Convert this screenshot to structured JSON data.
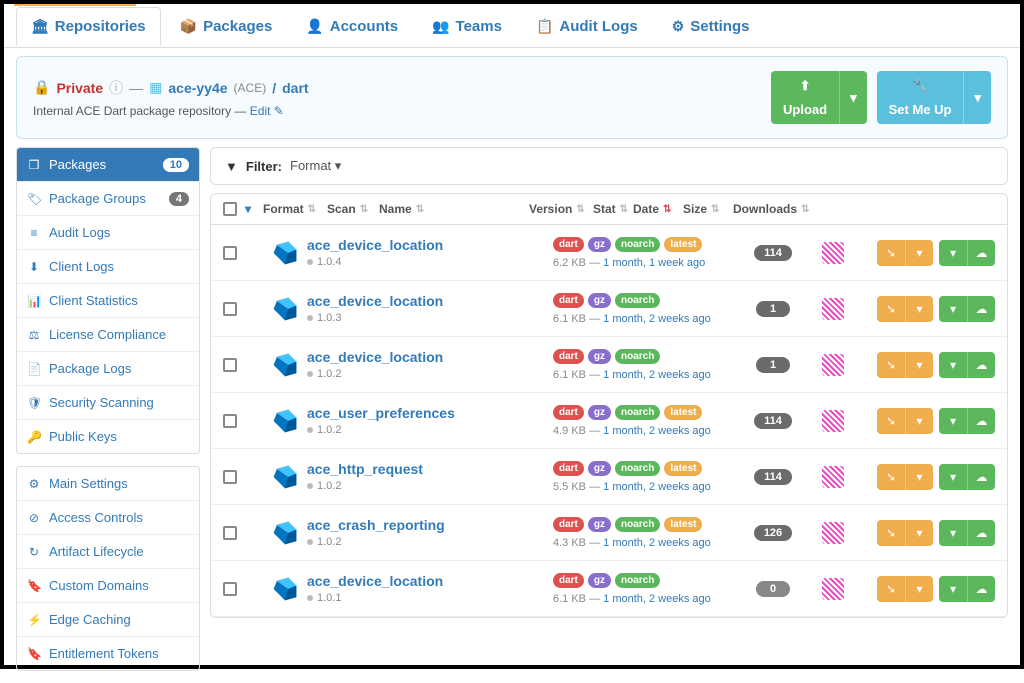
{
  "top_tabs": {
    "repositories": "Repositories",
    "packages": "Packages",
    "accounts": "Accounts",
    "teams": "Teams",
    "audit_logs": "Audit Logs",
    "settings": "Settings"
  },
  "header": {
    "privacy": "Private",
    "org": "ace-yy4e",
    "org_suffix": "(ACE)",
    "repo": "dart",
    "description": "Internal ACE Dart package repository —",
    "edit": "Edit",
    "upload": "Upload",
    "setup": "Set Me Up"
  },
  "sidebar": {
    "group1": [
      {
        "label": "Packages",
        "badge": "10",
        "active": true
      },
      {
        "label": "Package Groups",
        "badge": "4"
      },
      {
        "label": "Audit Logs"
      },
      {
        "label": "Client Logs"
      },
      {
        "label": "Client Statistics"
      },
      {
        "label": "License Compliance"
      },
      {
        "label": "Package Logs"
      },
      {
        "label": "Security Scanning"
      },
      {
        "label": "Public Keys"
      }
    ],
    "group2": [
      {
        "label": "Main Settings"
      },
      {
        "label": "Access Controls"
      },
      {
        "label": "Artifact Lifecycle"
      },
      {
        "label": "Custom Domains"
      },
      {
        "label": "Edge Caching"
      },
      {
        "label": "Entitlement Tokens"
      }
    ]
  },
  "filter": {
    "label": "Filter:",
    "format": "Format"
  },
  "columns": {
    "format": "Format",
    "scan": "Scan",
    "name": "Name",
    "version": "Version",
    "stat": "Stat",
    "date": "Date",
    "size": "Size",
    "downloads": "Downloads"
  },
  "packages": [
    {
      "name": "ace_device_location",
      "version": "1.0.4",
      "tags": [
        "dart",
        "gz",
        "noarch",
        "latest"
      ],
      "size": "6.2 KB",
      "date": "1 month, 1 week ago",
      "downloads": "114"
    },
    {
      "name": "ace_device_location",
      "version": "1.0.3",
      "tags": [
        "dart",
        "gz",
        "noarch"
      ],
      "size": "6.1 KB",
      "date": "1 month, 2 weeks ago",
      "downloads": "1"
    },
    {
      "name": "ace_device_location",
      "version": "1.0.2",
      "tags": [
        "dart",
        "gz",
        "noarch"
      ],
      "size": "6.1 KB",
      "date": "1 month, 2 weeks ago",
      "downloads": "1"
    },
    {
      "name": "ace_user_preferences",
      "version": "1.0.2",
      "tags": [
        "dart",
        "gz",
        "noarch",
        "latest"
      ],
      "size": "4.9 KB",
      "date": "1 month, 2 weeks ago",
      "downloads": "114"
    },
    {
      "name": "ace_http_request",
      "version": "1.0.2",
      "tags": [
        "dart",
        "gz",
        "noarch",
        "latest"
      ],
      "size": "5.5 KB",
      "date": "1 month, 2 weeks ago",
      "downloads": "114"
    },
    {
      "name": "ace_crash_reporting",
      "version": "1.0.2",
      "tags": [
        "dart",
        "gz",
        "noarch",
        "latest"
      ],
      "size": "4.3 KB",
      "date": "1 month, 2 weeks ago",
      "downloads": "126"
    },
    {
      "name": "ace_device_location",
      "version": "1.0.1",
      "tags": [
        "dart",
        "gz",
        "noarch"
      ],
      "size": "6.1 KB",
      "date": "1 month, 2 weeks ago",
      "downloads": "0"
    }
  ]
}
